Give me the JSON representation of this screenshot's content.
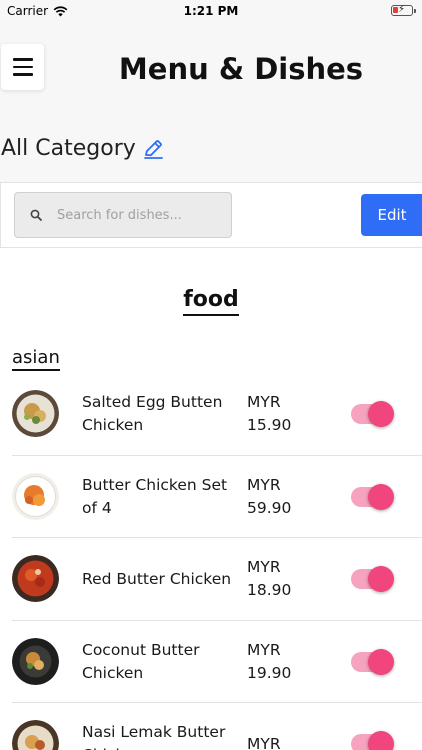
{
  "status_bar": {
    "carrier": "Carrier",
    "time": "1:21 PM"
  },
  "header": {
    "title": "Menu & Dishes",
    "category_title": "All Category"
  },
  "toolbar": {
    "search_placeholder": "Search for dishes...",
    "edit_label": "Edit"
  },
  "section": {
    "title": "food",
    "subsection": "asian"
  },
  "colors": {
    "accent_blue": "#2f6df6",
    "toggle_on": "#f0457d",
    "toggle_track": "#f5a3bf"
  },
  "dishes": [
    {
      "name": "Salted Egg Butten Chicken",
      "currency": "MYR",
      "price": "15.90",
      "available": true
    },
    {
      "name": "Butter Chicken Set of 4",
      "currency": "MYR",
      "price": "59.90",
      "available": true
    },
    {
      "name": "Red Butter Chicken",
      "currency": "MYR",
      "price": "18.90",
      "available": true
    },
    {
      "name": "Coconut Butter Chicken",
      "currency": "MYR",
      "price": "19.90",
      "available": true
    },
    {
      "name": "Nasi Lemak Butter Chicken",
      "currency": "MYR",
      "price": "",
      "available": true
    }
  ]
}
